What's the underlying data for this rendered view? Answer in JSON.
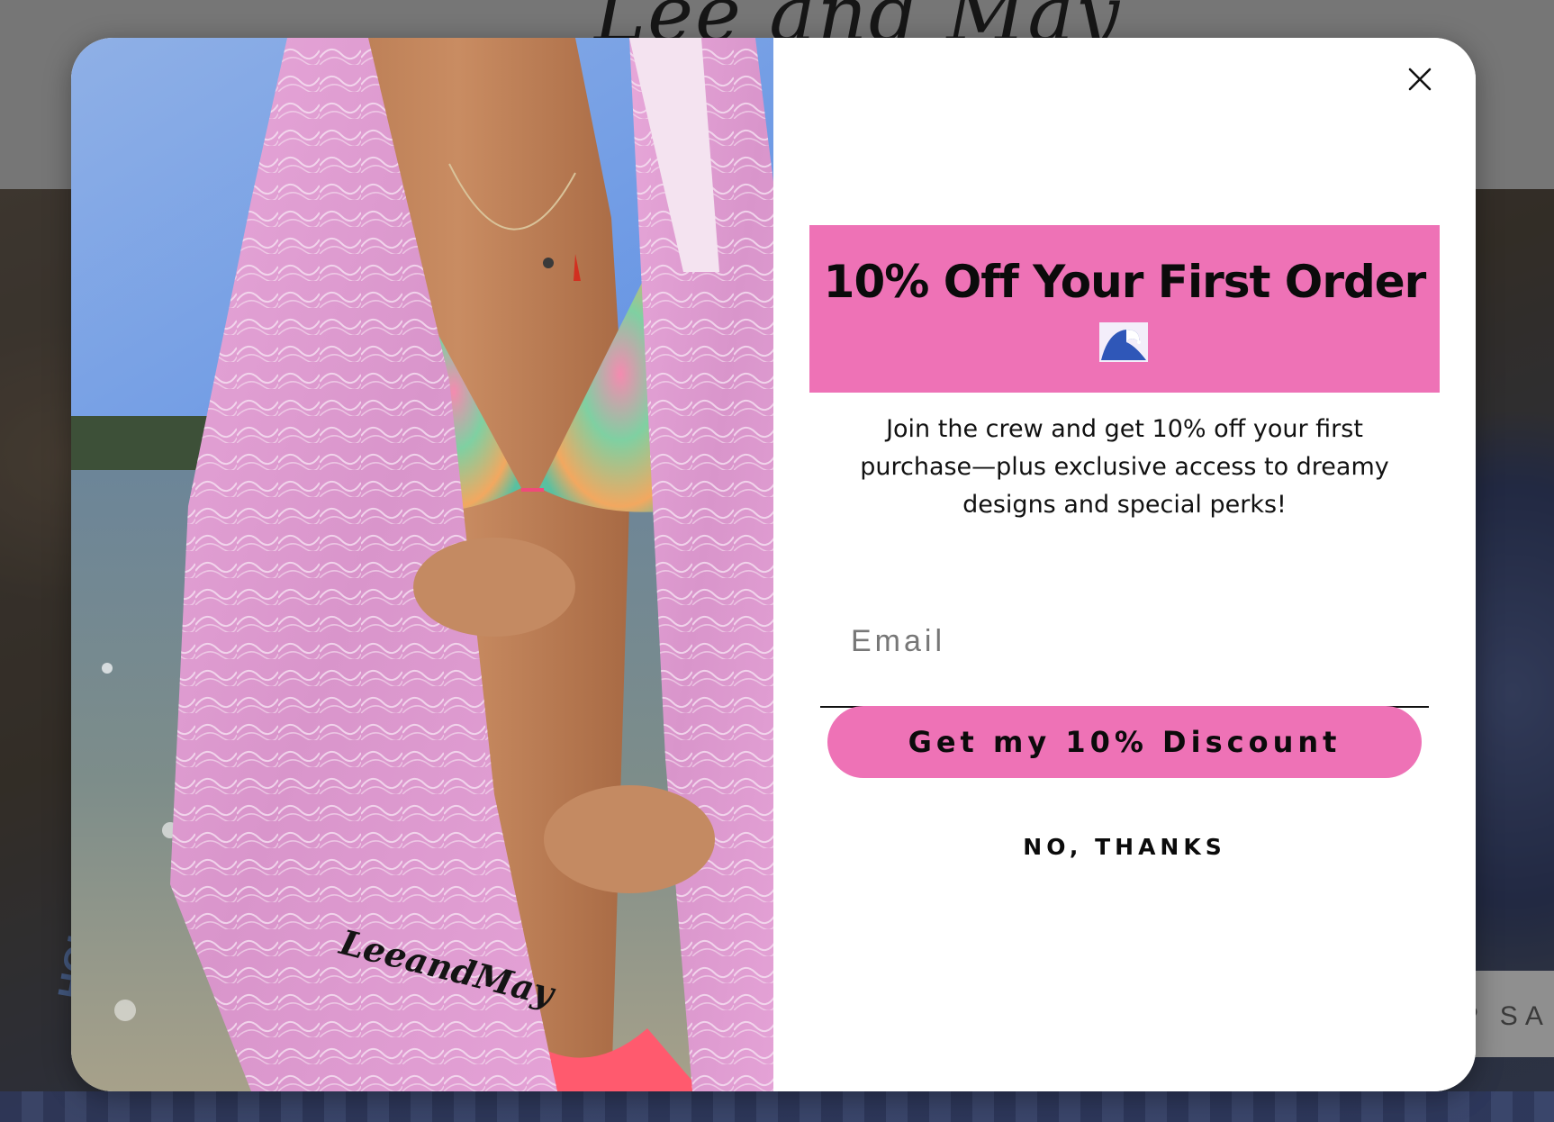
{
  "site": {
    "logo_text": "Lee and May",
    "hero_card_text": "P SA",
    "hero_side_text": "HOLIDAY"
  },
  "modal": {
    "photo_watermark": "LeeandMay",
    "close_icon": "close-icon",
    "headline": "10% Off Your First Order",
    "headline_emoji": "🌊",
    "description": "Join the crew and get 10% off your first purchase—plus exclusive access to dreamy designs and special perks!",
    "email_placeholder": "Email",
    "email_value": "",
    "cta_label": "Get my 10% Discount",
    "decline_label": "NO, THANKS"
  },
  "colors": {
    "accent_pink": "#ee72b6",
    "text_dark": "#0b0b0b",
    "overlay_grey": "#767676"
  }
}
